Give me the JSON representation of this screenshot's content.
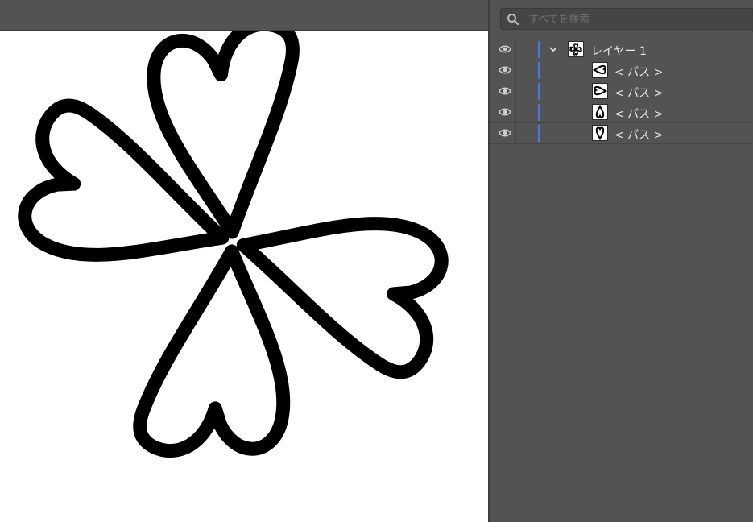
{
  "search": {
    "placeholder": "すべてを検索"
  },
  "layers": [
    {
      "name": "レイヤー 1",
      "thumbnail": "clover-thumbnail",
      "expanded": true,
      "visible": true
    },
    {
      "name": "< パス >",
      "thumbnail": "heart-right-thumbnail",
      "visible": true
    },
    {
      "name": "< パス >",
      "thumbnail": "heart-left-thumbnail",
      "visible": true
    },
    {
      "name": "< パス >",
      "thumbnail": "heart-down-thumbnail",
      "visible": true
    },
    {
      "name": "< パス >",
      "thumbnail": "heart-up-thumbnail",
      "visible": true
    }
  ],
  "colors": {
    "panel_bg": "#535353",
    "layer_color": "#4a76e8",
    "artboard": "#ffffff",
    "artwork": "#000000"
  }
}
